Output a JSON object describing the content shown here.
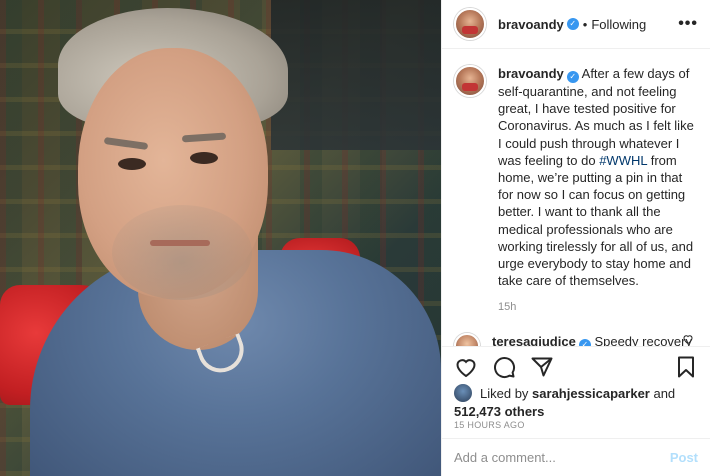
{
  "post": {
    "username": "bravoandy",
    "follow_status": "Following",
    "dot": "•",
    "more": "•••",
    "verified_glyph": "✓"
  },
  "caption": {
    "username": "bravoandy",
    "text_before": " After a few days of self-quarantine, and not feeling great, I have tested positive for Coronavirus.  As much as I felt like I could push through whatever I was feeling to do ",
    "hashtag": "#WWHL",
    "text_after": " from home, we’re putting a pin in that for now so I can focus on getting better.  I want to thank all the medical professionals who are working tirelessly for all of us, and urge everybody to stay home and take care of themselves.",
    "age": "15h"
  },
  "reply": {
    "username": "teresagiudice",
    "text": " Speedy recovery I know you will be fine. Love Love Love you 🙏 ❤"
  },
  "likes": {
    "prefix": "Liked by ",
    "user": "sarahjessicaparker",
    "joiner": " and",
    "count": "512,473 others"
  },
  "timestamp": "15 HOURS AGO",
  "add_comment": {
    "placeholder": "Add a comment...",
    "post_label": "Post"
  },
  "icons": [
    "heart-icon",
    "comment-icon",
    "share-icon",
    "bookmark-icon",
    "more-icon",
    "verified-icon"
  ],
  "colors": {
    "link": "#00376b",
    "verified": "#3897f0",
    "post_disabled": "#b2dffc",
    "meta": "#8e8e8e"
  }
}
